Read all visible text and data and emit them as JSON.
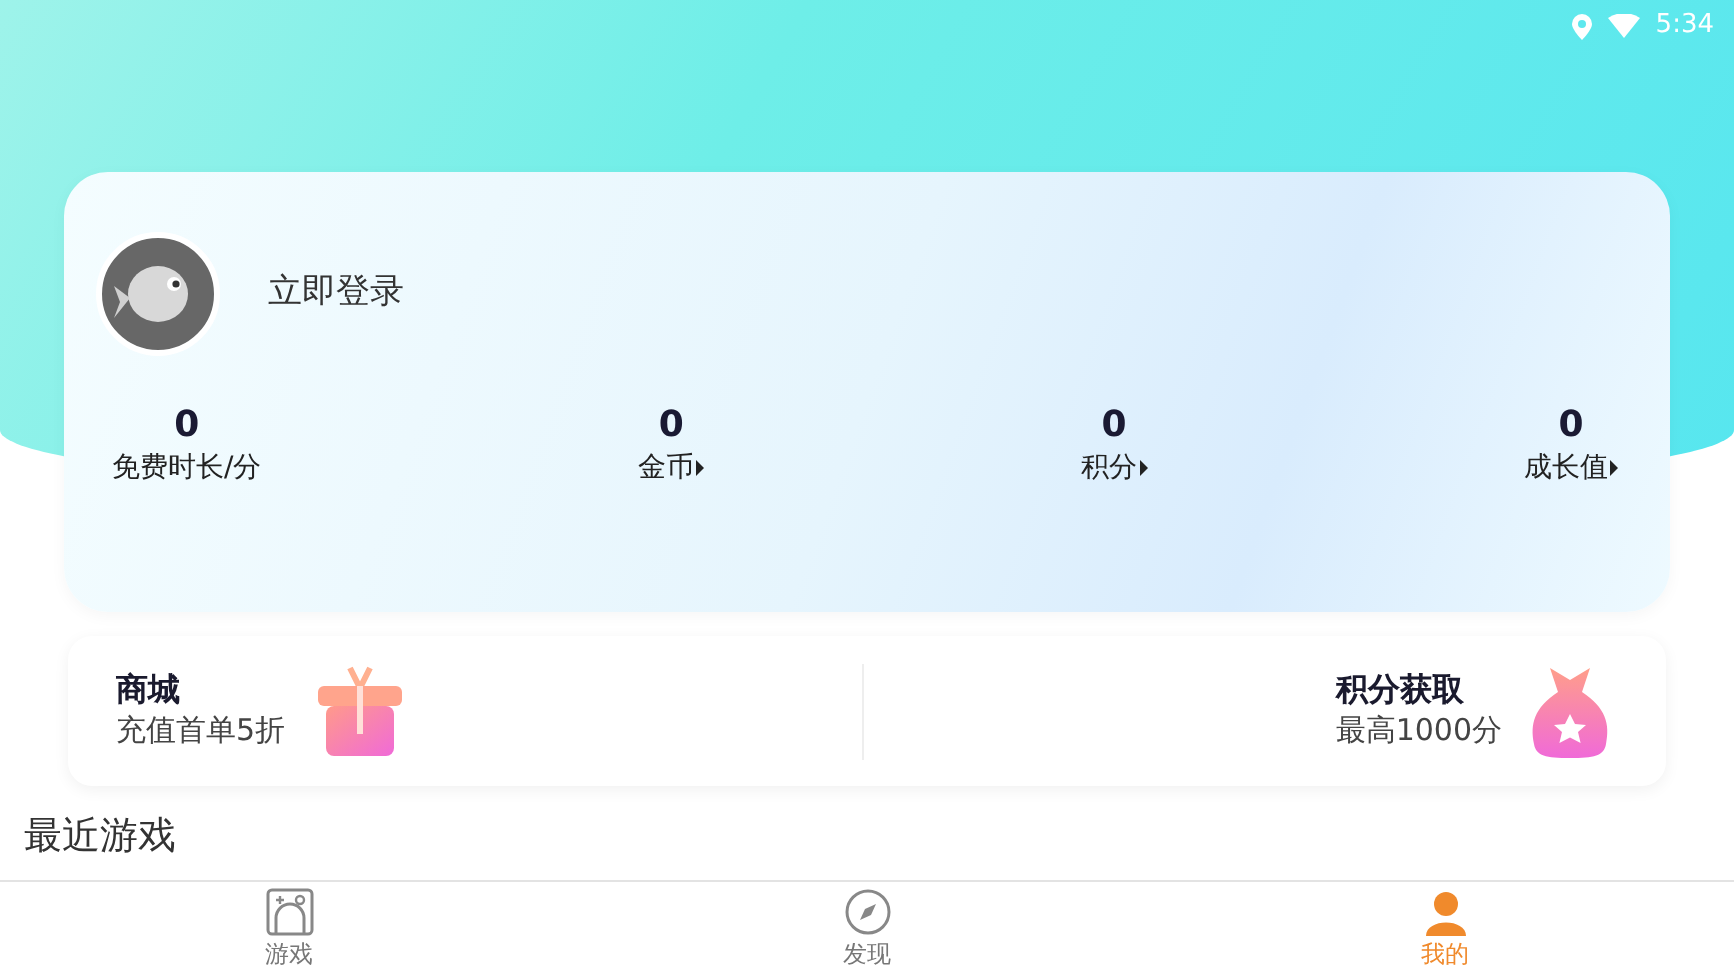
{
  "status_bar": {
    "time": "5:34"
  },
  "profile": {
    "login_text": "立即登录"
  },
  "stats": [
    {
      "value": "0",
      "label": "免费时长/分",
      "arrow": false
    },
    {
      "value": "0",
      "label": "金币",
      "arrow": true
    },
    {
      "value": "0",
      "label": "积分",
      "arrow": true
    },
    {
      "value": "0",
      "label": "成长值",
      "arrow": true
    }
  ],
  "promos": [
    {
      "title": "商城",
      "subtitle": "充值首单5折",
      "kind": "gift"
    },
    {
      "title": "积分获取",
      "subtitle": "最高1000分",
      "kind": "bag"
    }
  ],
  "section_title": "最近游戏",
  "tabs": [
    {
      "label": "游戏",
      "kind": "games",
      "selected": false
    },
    {
      "label": "发现",
      "kind": "discover",
      "selected": false
    },
    {
      "label": "我的",
      "kind": "me",
      "selected": true
    }
  ]
}
